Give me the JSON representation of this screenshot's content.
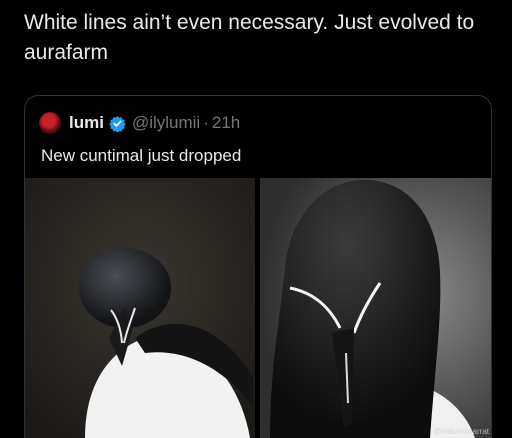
{
  "post": {
    "text": "White lines ain’t even necessary. Just evolved to aurafarm"
  },
  "quote": {
    "author_name": "lumi",
    "handle": "@ilylumii",
    "separator": "·",
    "time": "21h",
    "text": "New cuntimal just dropped",
    "verified_color": "#1d9bf0",
    "photo_watermark": "@naturesnarrat"
  }
}
